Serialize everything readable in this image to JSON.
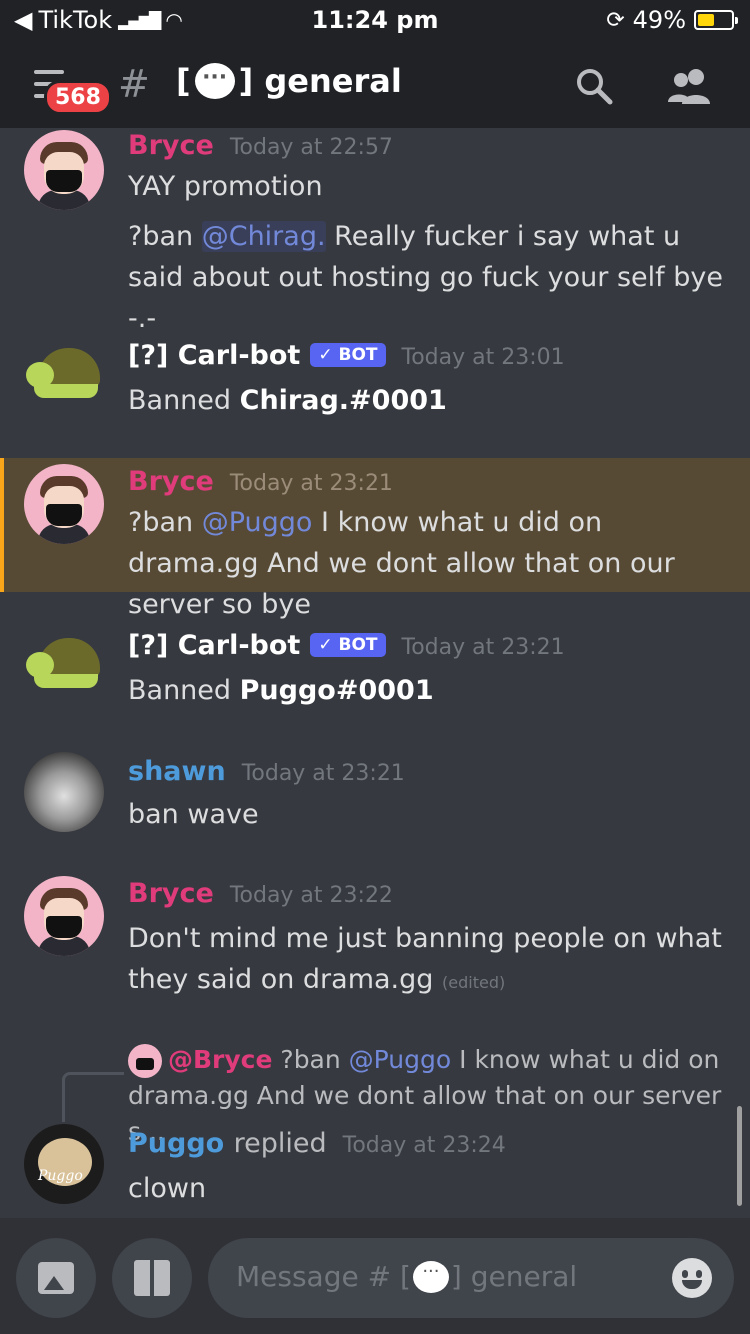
{
  "status_bar": {
    "back_app": "TikTok",
    "time": "11:24 pm",
    "battery": "49%",
    "battery_level": 0.49
  },
  "header": {
    "badge": "568",
    "channel_prefix": "[",
    "channel_suffix": "] general"
  },
  "messages": [
    {
      "author": "Bryce",
      "time": "Today at 22:57",
      "color": "#e03b7a",
      "lines": [
        "YAY promotion"
      ],
      "line2_prefix": "?ban ",
      "line2_mention": "@Chirag.",
      "line2_rest": " Really fucker i say what u said about out hosting go fuck your self bye -.-"
    },
    {
      "author": "[?] Carl-bot",
      "badge": "✓ BOT",
      "time": "Today at 23:01",
      "text_prefix": "Banned ",
      "text_bold": "Chirag.#0001"
    },
    {
      "author": "Bryce",
      "time": "Today at 23:21",
      "text_prefix": "?ban ",
      "mention": "@Puggo",
      "text_rest": " I know what u did on drama.gg And we dont allow that on our server so bye"
    },
    {
      "author": "[?] Carl-bot",
      "badge": "✓ BOT",
      "time": "Today at 23:21",
      "text_prefix": "Banned ",
      "text_bold": "Puggo#0001"
    },
    {
      "author": "shawn",
      "time": "Today at 23:21",
      "text": "ban wave",
      "color": "#4e9bdc"
    },
    {
      "author": "Bryce",
      "time": "Today at 23:22",
      "text": "Don't mind me just banning people on what they said on drama.gg",
      "edited": "(edited)"
    },
    {
      "author": "Puggo",
      "author_suffix": "replied",
      "time": "Today at 23:24",
      "text": "clown",
      "color": "#4e9bdc",
      "reply": {
        "name": "@Bryce",
        "prefix": "?ban ",
        "mention": "@Puggo",
        "rest": " I know what u did on drama.gg And we dont allow that on our server s..."
      }
    }
  ],
  "avatar_label_puggo": "Puggo",
  "composer": {
    "placeholder_prefix": "Message # [",
    "placeholder_suffix": "] general"
  }
}
